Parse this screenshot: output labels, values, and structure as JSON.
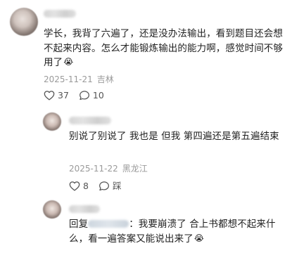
{
  "comments": [
    {
      "text": "学长，我背了六遍了，还是没办法输出，看到题目还会想不起来内容。怎么才能锻炼输出的能力啊，感觉时间不够用了",
      "emoji": "😭",
      "date": "2025-11-21",
      "location": "吉林",
      "likes": "37",
      "replies": "10"
    }
  ],
  "replies": [
    {
      "text": "别说了别说了 我也是 但我 第四遍还是第五遍结束",
      "date": "2025-11-22",
      "location": "黑龙江",
      "likes": "8",
      "dislike_label": "踩"
    },
    {
      "prefix": "回复",
      "text": "：我要崩溃了 合上书都想不起来什么，看一遍答案又能说出来了",
      "emoji": "😭"
    }
  ]
}
